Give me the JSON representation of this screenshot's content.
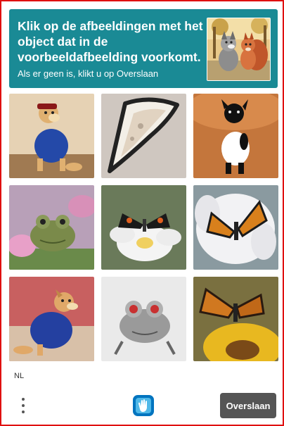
{
  "header": {
    "title": "Klik op de afbeeldingen met het object dat in de voorbeeldafbeelding voorkomt.",
    "subtitle": "Als er geen is, klikt u op Overslaan",
    "accent_color": "#1a8a95"
  },
  "example_image": {
    "subject": "dog-and-squirrel-illustration"
  },
  "grid": {
    "tiles": [
      {
        "subject": "dog in blue shirt"
      },
      {
        "subject": "pizza slice outline"
      },
      {
        "subject": "dog in white shirt"
      },
      {
        "subject": "frog on flowers"
      },
      {
        "subject": "butterfly on white flower"
      },
      {
        "subject": "butterfly on white flower"
      },
      {
        "subject": "dog in blue shirt"
      },
      {
        "subject": "frog sketch"
      },
      {
        "subject": "butterfly on sunflower"
      }
    ]
  },
  "footer": {
    "language": "NL",
    "skip_label": "Overslaan",
    "menu_icon": "vertical-dots-icon",
    "logo_icon": "hcaptcha-logo-icon"
  },
  "frame_color": "#e01010"
}
